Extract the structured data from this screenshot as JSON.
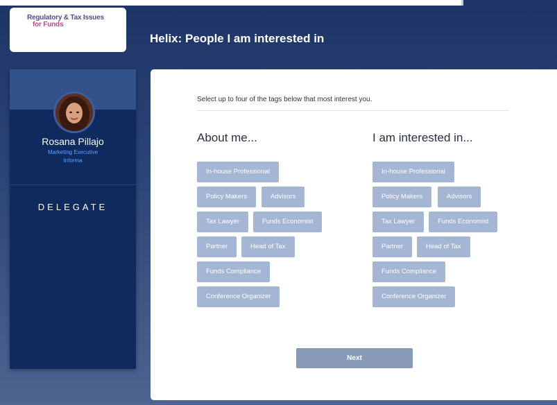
{
  "logo": {
    "line1": "Regulatory & Tax Issues",
    "line2": "for Funds"
  },
  "header": {
    "title": "Helix: People I am interested in"
  },
  "profile": {
    "name": "Rosana Pillajo",
    "role": "Marketing Executive",
    "company": "Informa",
    "type": "DELEGATE"
  },
  "main": {
    "instruction": "Select up to four of the tags below that most interest you.",
    "about_heading": "About me...",
    "interested_heading": "I am interested in...",
    "about_tags": [
      "In-house Professional",
      "Policy Makers",
      "Advisors",
      "Tax Lawyer",
      "Funds Economist",
      "Partner",
      "Head of Tax",
      "Funds Compliance",
      "Conference Organizer"
    ],
    "interested_tags": [
      "In-house Professional",
      "Policy Makers",
      "Advisors",
      "Tax Lawyer",
      "Funds Economist",
      "Partner",
      "Head of Tax",
      "Funds Compliance",
      "Conference Organizer"
    ],
    "next_label": "Next"
  },
  "colors": {
    "tag_background": "#a4b6d3",
    "sidebar": "#0f2a5f",
    "accent_blue": "#5fa3ff",
    "logo_pink": "#c23f9a"
  }
}
